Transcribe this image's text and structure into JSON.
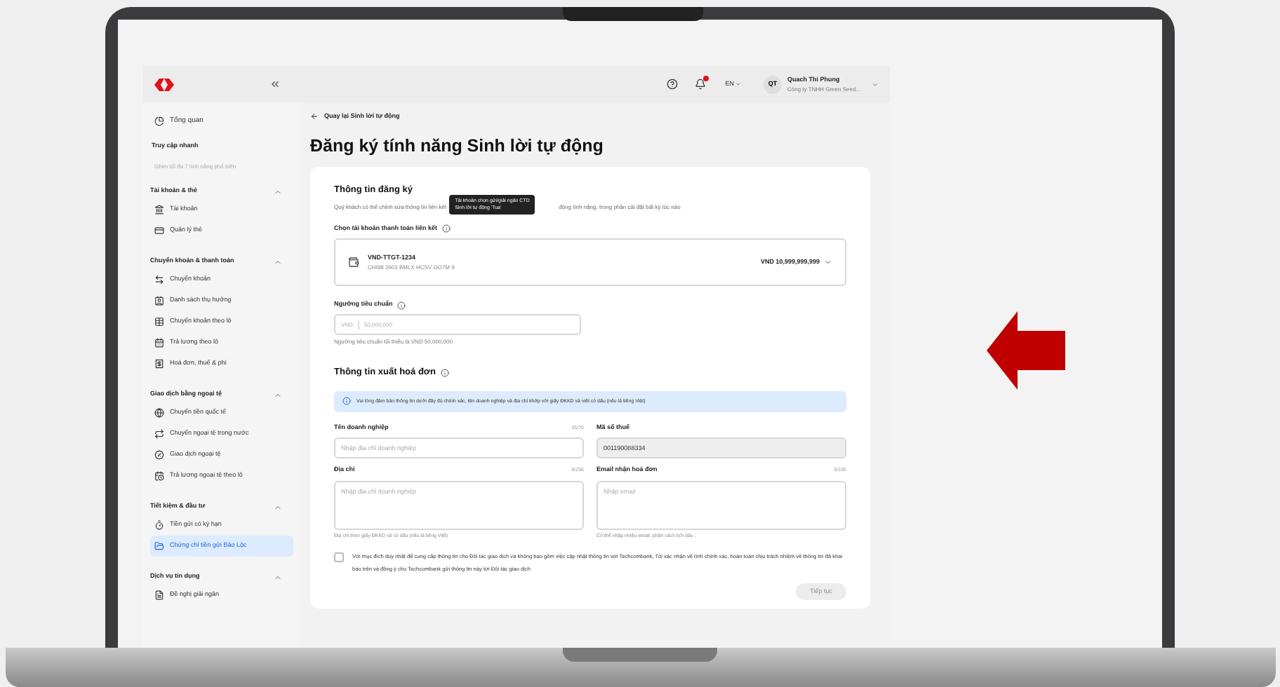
{
  "header": {
    "notification_badge": true,
    "language": "EN",
    "user": {
      "initials": "QT",
      "name": "Quach Thi Phung",
      "company": "Công ty TNHH Green Seed..."
    }
  },
  "sidebar": {
    "overview": {
      "label": "Tổng quan",
      "selected": false
    },
    "quick_access": {
      "title": "Truy cập nhanh",
      "hint": "Ghim tối đa 7 tính năng phổ biến"
    },
    "sections": [
      {
        "title": "Tài khoản & thẻ",
        "expanded": true,
        "items": [
          {
            "label": "Tài khoản",
            "selected": false
          },
          {
            "label": "Quản lý thẻ",
            "selected": false
          }
        ]
      },
      {
        "title": "Chuyển khoản & thanh toán",
        "expanded": true,
        "items": [
          {
            "label": "Chuyển khoản",
            "selected": false
          },
          {
            "label": "Danh sách thụ hưởng",
            "selected": false
          },
          {
            "label": "Chuyển khoản theo lô",
            "selected": false
          },
          {
            "label": "Trả lương theo lô",
            "selected": false
          },
          {
            "label": "Hoá đơn, thuế & phí",
            "selected": false
          }
        ]
      },
      {
        "title": "Giao dịch bằng ngoại tệ",
        "expanded": true,
        "items": [
          {
            "label": "Chuyển tiền quốc tế",
            "selected": false
          },
          {
            "label": "Chuyển ngoại tệ trong nước",
            "selected": false
          },
          {
            "label": "Giao dịch ngoại tệ",
            "selected": false
          },
          {
            "label": "Trả lương ngoại tệ theo lô",
            "selected": false
          }
        ]
      },
      {
        "title": "Tiết kiệm & đầu tư",
        "expanded": true,
        "items": [
          {
            "label": "Tiền gửi có kỳ hạn",
            "selected": false
          },
          {
            "label": "Chứng chỉ tiền gửi Bảo Lộc",
            "selected": true
          }
        ]
      },
      {
        "title": "Dịch vụ tín dụng",
        "expanded": true,
        "items": [
          {
            "label": "Đề nghị giải ngân",
            "selected": false
          }
        ]
      }
    ]
  },
  "main": {
    "back_link": "Quay lại Sinh lời tự động",
    "title": "Đăng ký tính năng Sinh lời tự động",
    "registration": {
      "title": "Thông tin đăng ký",
      "description_start": "Quý khách có thể chỉnh sửa thông tin liên kết",
      "description_end": "động tính năng, trong phần cài đặt bất kỳ lúc nào",
      "tooltip": [
        "Tài khoản chọn gửi/giải ngân CTD",
        "Sinh lời tự động 'Tua'"
      ],
      "account_label": "Chọn tài khoản thanh toán liên kết",
      "account": {
        "name": "VND-TTGT-1234",
        "detail": "CHI88 2903 BMLX HCSV OO7M 9",
        "balance": "VND 10,999,999,999"
      },
      "threshold_label": "Ngưỡng tiêu chuẩn",
      "threshold": {
        "currency": "VND",
        "placeholder": "50,000,000",
        "hint": "Ngưỡng tiêu chuẩn tối thiểu là VND 50,000,000"
      }
    },
    "invoice": {
      "title": "Thông tin xuất hoá đơn",
      "notice": "Vui lòng đảm bảo thông tin dưới đây đủ chính xác, tên doanh nghiệp và địa chỉ khớp với giấy ĐKKD và viết có dấu (nếu là tiếng Việt)",
      "fields": [
        {
          "kind": "input",
          "label": "Tên doanh nghiệp",
          "counter": "25/70",
          "placeholder": "Nhập địa chỉ doanh nghiệp",
          "disabled": false
        },
        {
          "kind": "input",
          "label": "Mã số thuế",
          "value": "001190088334",
          "disabled": true
        },
        {
          "kind": "textarea",
          "label": "Địa chỉ",
          "counter": "0/256",
          "placeholder": "Nhập địa chỉ doanh nghiệp",
          "hint": "Địa chỉ theo giấy ĐKKD và có dấu (nếu là tiếng Việt)",
          "disabled": false
        },
        {
          "kind": "textarea",
          "label": "Email nhận hoá đơn",
          "counter": "0/100",
          "placeholder": "Nhập email",
          "hint": "Có thể nhập nhiều email, phân cách bởi dấu ;",
          "disabled": false
        }
      ],
      "consent": {
        "checked": false,
        "text": "Với mục đích duy nhất để cung cấp thông tin cho Đối tác giao dịch và không bao gồm việc cập nhật thông tin với Techcombank, Tôi xác nhận về tính chính xác, hoàn toàn chịu trách nhiệm về thông tin đã khai báo trên và đồng ý cho Techcombank gửi thông tin này tới Đối tác giao dịch"
      }
    },
    "continue_button": {
      "label": "Tiếp tục",
      "disabled": true
    }
  }
}
